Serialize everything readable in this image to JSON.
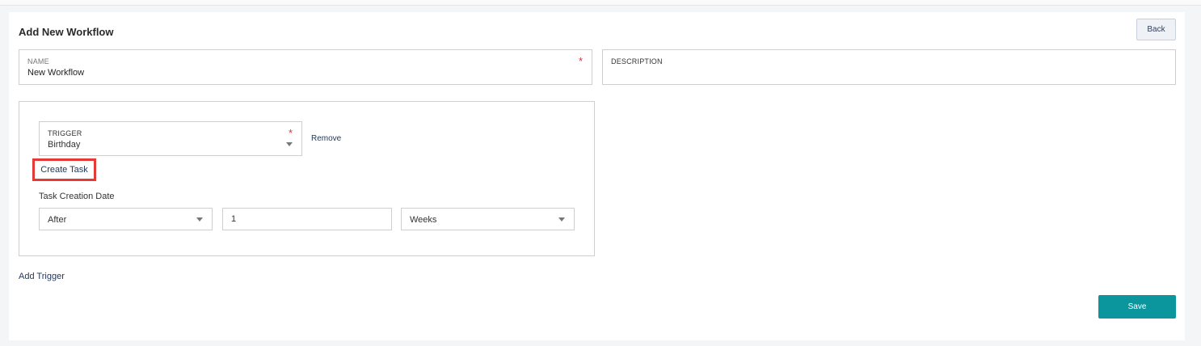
{
  "page": {
    "title": "Add New Workflow",
    "back_label": "Back",
    "save_label": "Save",
    "add_trigger_label": "Add Trigger"
  },
  "name_field": {
    "label": "NAME",
    "value": "New Workflow",
    "required_mark": "*"
  },
  "description_field": {
    "label": "DESCRIPTION",
    "value": ""
  },
  "trigger": {
    "label": "TRIGGER",
    "value": "Birthday",
    "required_mark": "*",
    "remove_label": "Remove",
    "create_task_label": "Create Task",
    "task_creation_date_label": "Task Creation Date",
    "timing_select": "After",
    "amount_value": "1",
    "unit_select": "Weeks"
  },
  "colors": {
    "accent": "#0b969d",
    "highlight": "#e53935",
    "required": "#e0332f",
    "link": "#23395d"
  },
  "icons": {
    "dropdown": "chevron-down-icon"
  }
}
